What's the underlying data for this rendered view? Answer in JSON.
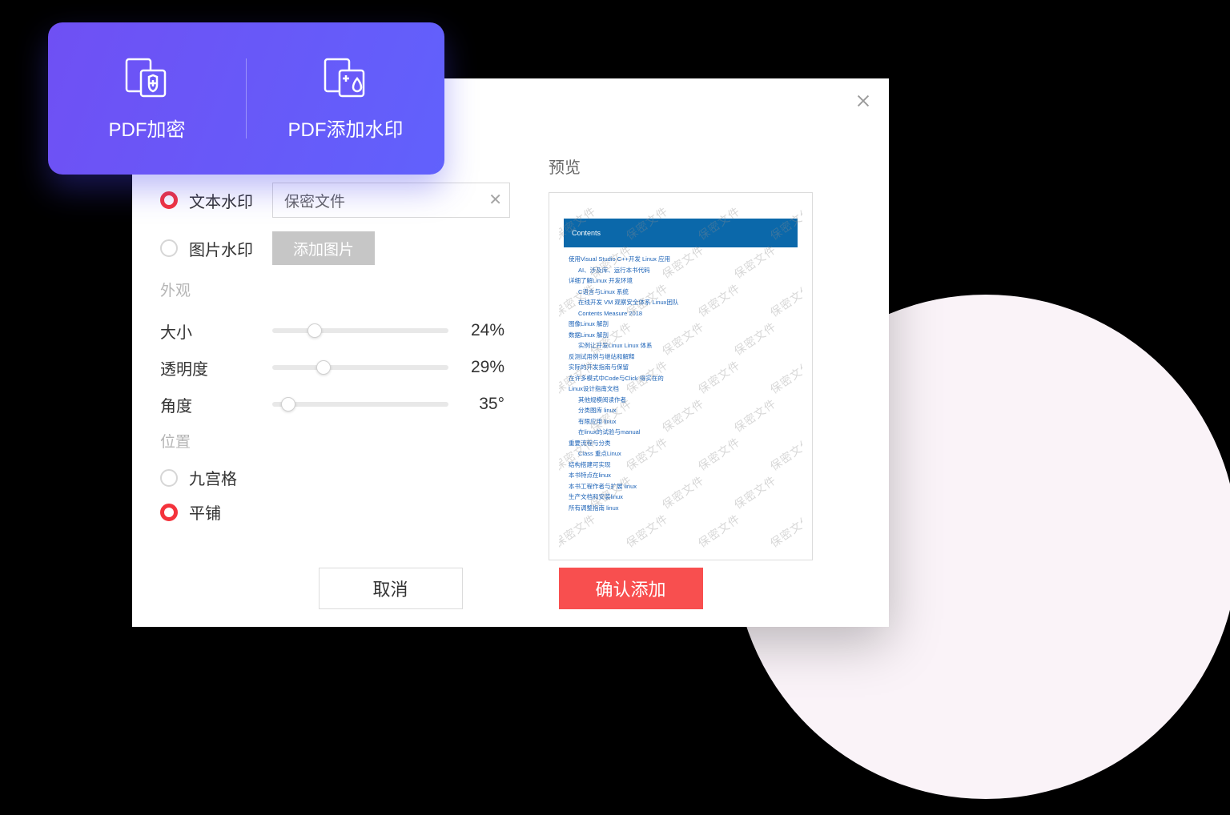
{
  "card": {
    "encrypt_label": "PDF加密",
    "watermark_label": "PDF添加水印"
  },
  "dialog": {
    "watermark_type": {
      "text": {
        "label": "文本水印",
        "value": "保密文件",
        "selected": true
      },
      "image": {
        "label": "图片水印",
        "button": "添加图片",
        "selected": false
      }
    },
    "appearance": {
      "title": "外观",
      "size": {
        "label": "大小",
        "value": 24,
        "display": "24%"
      },
      "opacity": {
        "label": "透明度",
        "value": 29,
        "display": "29%"
      },
      "angle": {
        "label": "角度",
        "value": 35,
        "display": "35°"
      }
    },
    "position": {
      "title": "位置",
      "grid": {
        "label": "九宫格",
        "selected": false
      },
      "tile": {
        "label": "平铺",
        "selected": true
      }
    },
    "preview": {
      "title": "预览",
      "header": "Contents",
      "watermark_text": "保密文件",
      "lines": [
        {
          "t": "使用Visual Studio C++开发 Linux 应用",
          "i": 0
        },
        {
          "t": "AI、涉及库、运行本书代码",
          "i": 1
        },
        {
          "t": "详细了解Linux 开发环境",
          "i": 0
        },
        {
          "t": "C语言与Linux 系统",
          "i": 1
        },
        {
          "t": "在线开发 VM 观察安全体系 Linux团队",
          "i": 1
        },
        {
          "t": "Contents Measure 2018",
          "i": 1
        },
        {
          "t": "图像Linux 解剖",
          "i": 0
        },
        {
          "t": "数据Linux 解剖",
          "i": 0
        },
        {
          "t": "实例让开发Linux Linux 体系",
          "i": 1
        },
        {
          "t": "反测试用例与继站和解释",
          "i": 0
        },
        {
          "t": "实际的开发指南与保留",
          "i": 0
        },
        {
          "t": "在许多模式中Code与Click 得实在的",
          "i": 0
        },
        {
          "t": "Linux设计指南文档",
          "i": 0
        },
        {
          "t": "其他规模阅读作者",
          "i": 1
        },
        {
          "t": "分类图库 linux",
          "i": 1
        },
        {
          "t": "有限应用 linux",
          "i": 1
        },
        {
          "t": "在linux的试验与manual",
          "i": 1
        },
        {
          "t": "重要流程与分类",
          "i": 0
        },
        {
          "t": "Class 重点Linux",
          "i": 1
        },
        {
          "t": "结构搭建可实现",
          "i": 0
        },
        {
          "t": "本书特点在linux",
          "i": 0
        },
        {
          "t": "本书工程作者与扩展 linux",
          "i": 0
        },
        {
          "t": "生产文档和安装linux",
          "i": 0
        },
        {
          "t": "所有调整指南 linux",
          "i": 0
        }
      ]
    },
    "cancel": "取消",
    "confirm": "确认添加"
  }
}
